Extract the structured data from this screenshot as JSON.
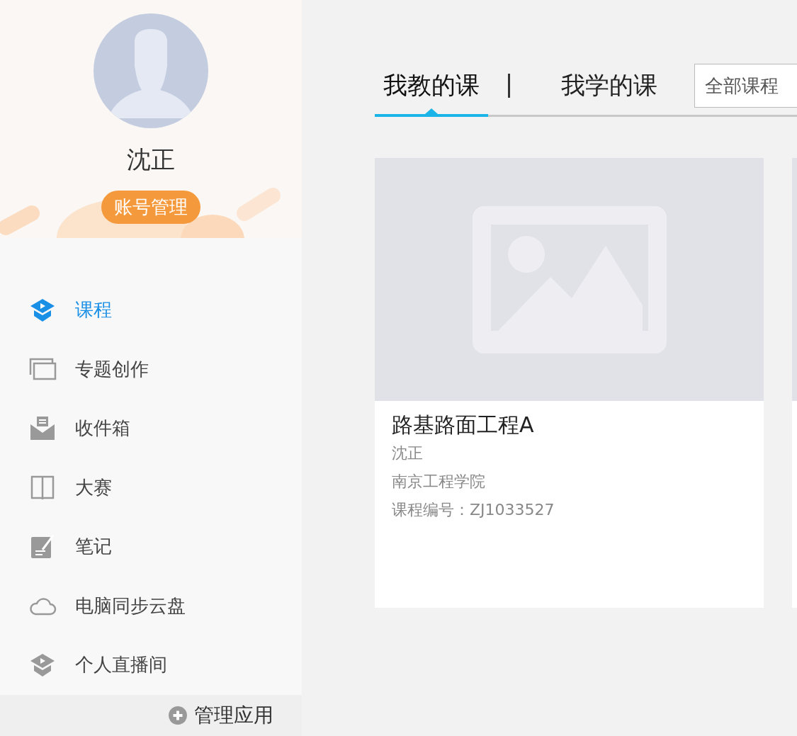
{
  "profile": {
    "name": "沈正",
    "account_button": "账号管理"
  },
  "nav": [
    {
      "label": "课程",
      "kind": "course",
      "selected": true
    },
    {
      "label": "专题创作",
      "kind": "topic",
      "selected": false
    },
    {
      "label": "收件箱",
      "kind": "inbox",
      "selected": false
    },
    {
      "label": "大赛",
      "kind": "contest",
      "selected": false
    },
    {
      "label": "笔记",
      "kind": "notes",
      "selected": false
    },
    {
      "label": "电脑同步云盘",
      "kind": "cloud",
      "selected": false
    },
    {
      "label": "个人直播间",
      "kind": "live",
      "selected": false
    }
  ],
  "manage_apps": {
    "label": "管理应用"
  },
  "tabs": [
    {
      "label": "我教的课",
      "selected": true
    },
    {
      "label": "我学的课",
      "selected": false
    }
  ],
  "filter": {
    "value": "全部课程"
  },
  "courses": [
    {
      "title": "路基路面工程A",
      "teacher": "沈正",
      "school": "南京工程学院",
      "code": "课程编号：ZJ1033527"
    }
  ]
}
